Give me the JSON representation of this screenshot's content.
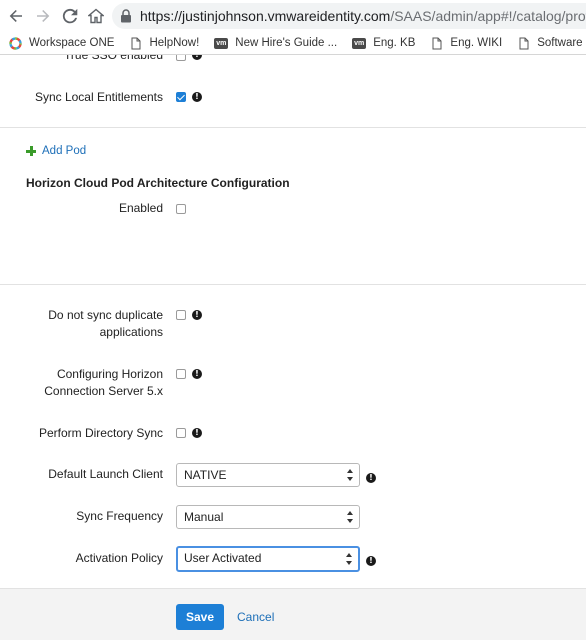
{
  "browser": {
    "url_host": "https://justinjohnson.vmwareidentity.com",
    "url_path": "/SAAS/admin/app#!/catalog/profiles/ed",
    "bookmarks": [
      {
        "label": "Workspace ONE",
        "icon": "workspace-one-icon"
      },
      {
        "label": "HelpNow!",
        "icon": "page-icon"
      },
      {
        "label": "New Hire's Guide ...",
        "icon": "vm-icon"
      },
      {
        "label": "Eng. KB",
        "icon": "vm-icon"
      },
      {
        "label": "Eng. WIKI",
        "icon": "page-icon"
      },
      {
        "label": "Software Portal",
        "icon": "page-icon"
      }
    ],
    "vm_badge": "vm"
  },
  "form": {
    "true_sso_label": "True SSO enabled",
    "sync_local_entitlements": {
      "label": "Sync Local Entitlements",
      "checked": true
    },
    "add_pod_label": "Add Pod",
    "cpa_section_title": "Horizon Cloud Pod Architecture Configuration",
    "cpa_enabled": {
      "label": "Enabled",
      "checked": false
    },
    "no_sync_duplicate": {
      "label_line1": "Do not sync duplicate",
      "label_line2": "applications",
      "checked": false
    },
    "horizon_5x": {
      "label_line1": "Configuring Horizon",
      "label_line2": "Connection Server 5.x",
      "checked": false
    },
    "directory_sync": {
      "label": "Perform Directory Sync",
      "checked": false
    },
    "default_launch_client": {
      "label": "Default Launch Client",
      "value": "NATIVE"
    },
    "sync_frequency": {
      "label": "Sync Frequency",
      "value": "Manual"
    },
    "activation_policy": {
      "label": "Activation Policy",
      "value": "User Activated"
    },
    "info_glyph": "!"
  },
  "footer": {
    "save_label": "Save",
    "cancel_label": "Cancel"
  },
  "colors": {
    "accent": "#1d7fd6",
    "link": "#1d6fb8",
    "plus_green": "#3a9b2a"
  }
}
